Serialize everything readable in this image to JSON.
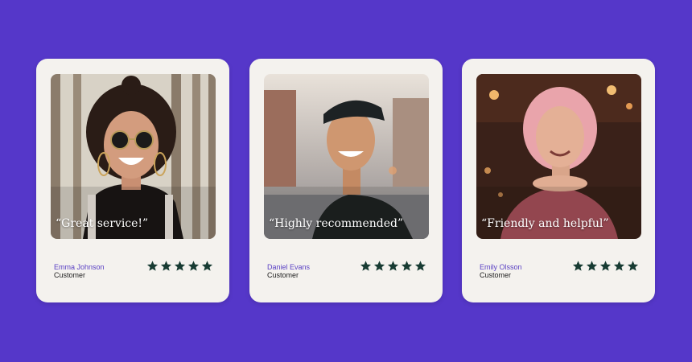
{
  "colors": {
    "background": "#5537c9",
    "card": "#f4f2ee",
    "name": "#5a41c4",
    "role": "#1c1c1c",
    "star": "#173b32"
  },
  "testimonials": [
    {
      "quote": "“Great service!”",
      "name": "Emma Johnson",
      "role": "Customer",
      "rating": 5
    },
    {
      "quote": "“Highly recommended”",
      "name": "Daniel Evans",
      "role": "Customer",
      "rating": 5
    },
    {
      "quote": "“Friendly and helpful”",
      "name": "Emily Olsson",
      "role": "Customer",
      "rating": 5
    }
  ]
}
